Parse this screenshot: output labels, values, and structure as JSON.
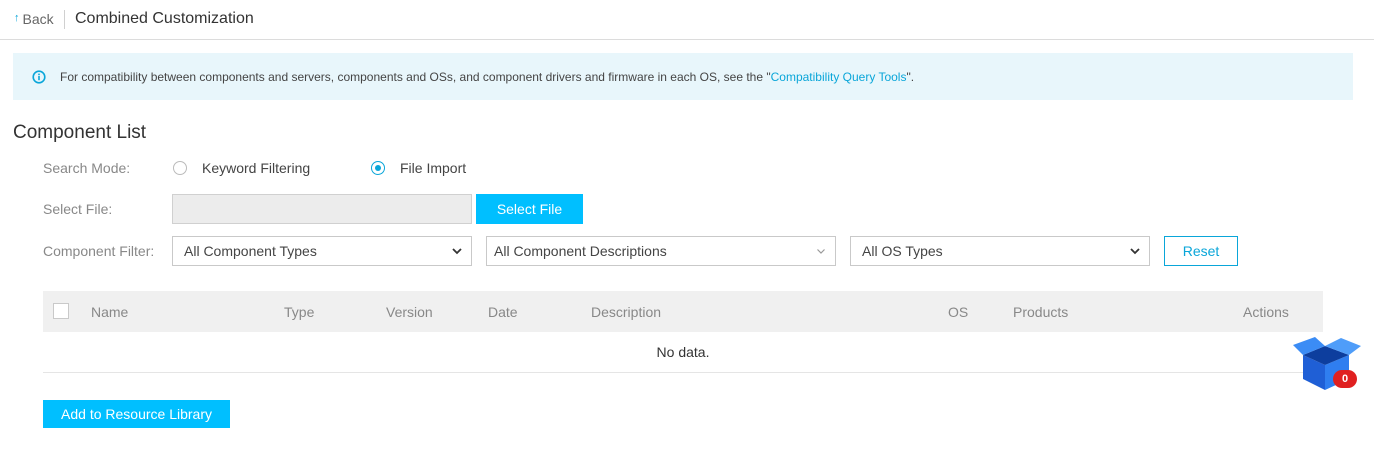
{
  "header": {
    "back_label": "Back",
    "back_arrow": "↑",
    "title": "Combined Customization"
  },
  "notice": {
    "text_before": "For compatibility between components and servers, components and OSs, and component drivers and firmware in each OS, see the \"",
    "link_text": "Compatibility Query Tools",
    "text_after": "\"."
  },
  "section_title": "Component List",
  "search_mode": {
    "label": "Search Mode:",
    "options": [
      {
        "label": "Keyword Filtering",
        "selected": false
      },
      {
        "label": "File Import",
        "selected": true
      }
    ]
  },
  "select_file": {
    "label": "Select File:",
    "value": "",
    "button_label": "Select File"
  },
  "component_filter": {
    "label": "Component Filter:",
    "type_select": "All Component Types",
    "description_select": "All Component Descriptions",
    "os_select": "All OS Types",
    "reset_label": "Reset"
  },
  "table": {
    "columns": [
      "Name",
      "Type",
      "Version",
      "Date",
      "Description",
      "OS",
      "Products",
      "Actions"
    ],
    "empty_text": "No data."
  },
  "add_button_label": "Add to Resource Library",
  "cart": {
    "count": "0",
    "icon": "box-icon"
  },
  "colors": {
    "accent": "#00bfff",
    "link": "#0aa6d9",
    "notice_bg": "#e8f6fb",
    "badge": "#e02020"
  }
}
